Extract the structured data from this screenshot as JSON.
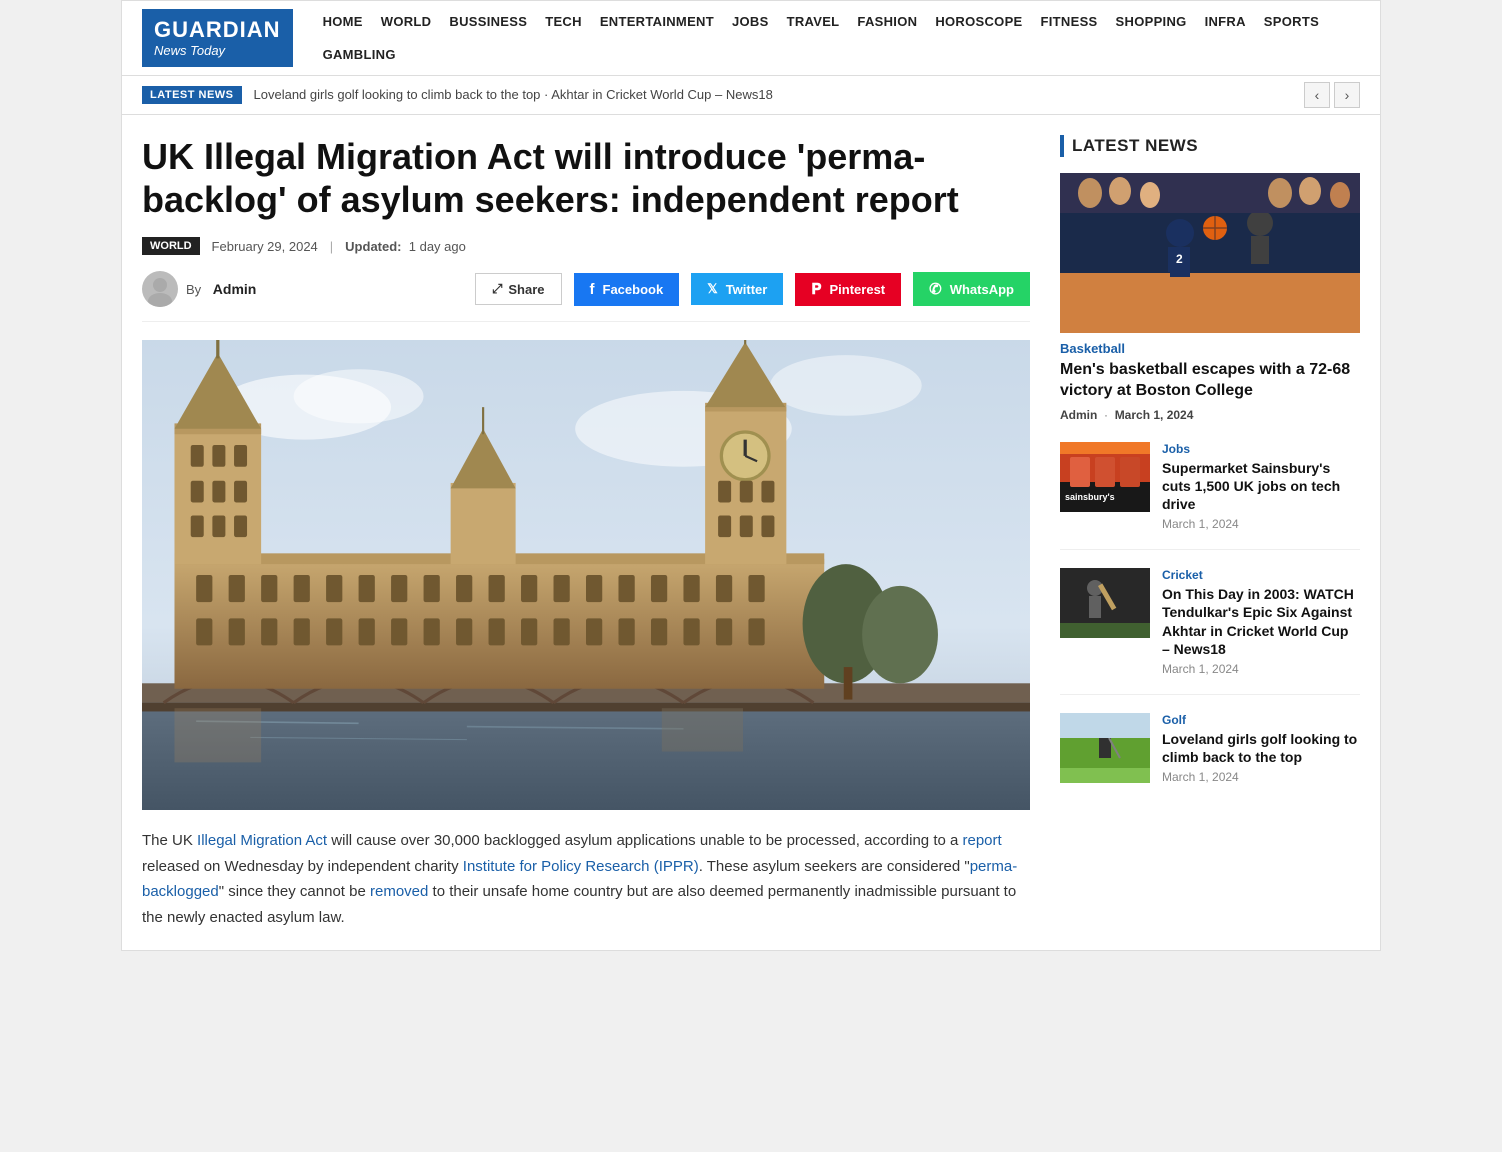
{
  "logo": {
    "top": "GUARDIAN",
    "bottom": "News Today"
  },
  "nav": {
    "items": [
      "HOME",
      "WORLD",
      "BUSSINESS",
      "TECH",
      "ENTERTAINMENT",
      "JOBS",
      "TRAVEL",
      "FASHION",
      "HOROSCOPE",
      "FITNESS",
      "SHOPPING",
      "INFRA",
      "SPORTS",
      "GAMBLING"
    ]
  },
  "ticker": {
    "label": "LATEST NEWS",
    "text": "Loveland girls golf looking to climb back to the top  ·  Akhtar in Cricket World Cup – News18"
  },
  "article": {
    "title": "UK Illegal Migration Act will introduce 'perma-backlog' of asylum seekers: independent report",
    "category": "WORLD",
    "date": "February 29, 2024",
    "updated_label": "Updated:",
    "updated_value": "1 day ago",
    "author": "Admin",
    "by_label": "By",
    "share_label": "Share",
    "share_icon": "⤢",
    "facebook_label": "Facebook",
    "twitter_label": "Twitter",
    "pinterest_label": "Pinterest",
    "whatsapp_label": "WhatsApp",
    "body_html": "The UK <a href='#'>Illegal Migration Act</a> will cause over 30,000 backlogged asylum applications unable to be processed, according to a <a href='#'>report</a> released on Wednesday by independent charity <a href='#'>Institute for Policy Research (IPPR)</a>. These asylum seekers are considered \"<a href='#'>perma-backlogged</a>\" since they cannot be <a href='#'>removed</a> to their unsafe home country but are also deemed permanently inadmissible pursuant to the newly enacted asylum law."
  },
  "latest_news": {
    "header": "LATEST NEWS",
    "items": [
      {
        "category": "Basketball",
        "title": "Men's basketball escapes with a 72-68 victory at Boston College",
        "author": "Admin",
        "date": "March 1, 2024",
        "type": "featured"
      },
      {
        "category": "Jobs",
        "title": "Supermarket Sainsbury's cuts 1,500 UK jobs on tech drive",
        "date": "March 1, 2024",
        "type": "small",
        "img_class": "img-sainsburys"
      },
      {
        "category": "Cricket",
        "title": "On This Day in 2003: WATCH Tendulkar's Epic Six Against Akhtar in Cricket World Cup – News18",
        "date": "March 1, 2024",
        "type": "small",
        "img_class": "img-cricket"
      },
      {
        "category": "Golf",
        "title": "Loveland girls golf looking to climb back to the top",
        "date": "March 1, 2024",
        "type": "small",
        "img_class": "img-golf"
      }
    ]
  }
}
